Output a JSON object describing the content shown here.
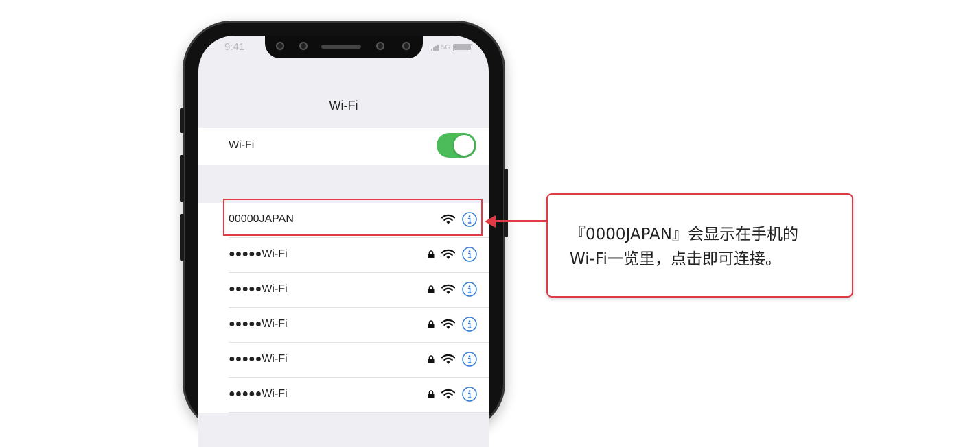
{
  "status_bar": {
    "time": "9:41",
    "network": "5G"
  },
  "nav": {
    "title": "Wi-Fi"
  },
  "wifi_toggle": {
    "label": "Wi-Fi",
    "on": true,
    "on_color": "#4cbb5a"
  },
  "networks": [
    {
      "name": "00000JAPAN",
      "locked": false
    },
    {
      "name": "●●●●●Wi-Fi",
      "locked": true
    },
    {
      "name": "●●●●●Wi-Fi",
      "locked": true
    },
    {
      "name": "●●●●●Wi-Fi",
      "locked": true
    },
    {
      "name": "●●●●●Wi-Fi",
      "locked": true
    },
    {
      "name": "●●●●●Wi-Fi",
      "locked": true
    }
  ],
  "callout": {
    "line1": "『0000JAPAN』会显示在手机的",
    "line2": "Wi-Fi一览里，点击即可连接。"
  },
  "colors": {
    "highlight": "#e03b45",
    "info_icon": "#2f7bd9"
  }
}
